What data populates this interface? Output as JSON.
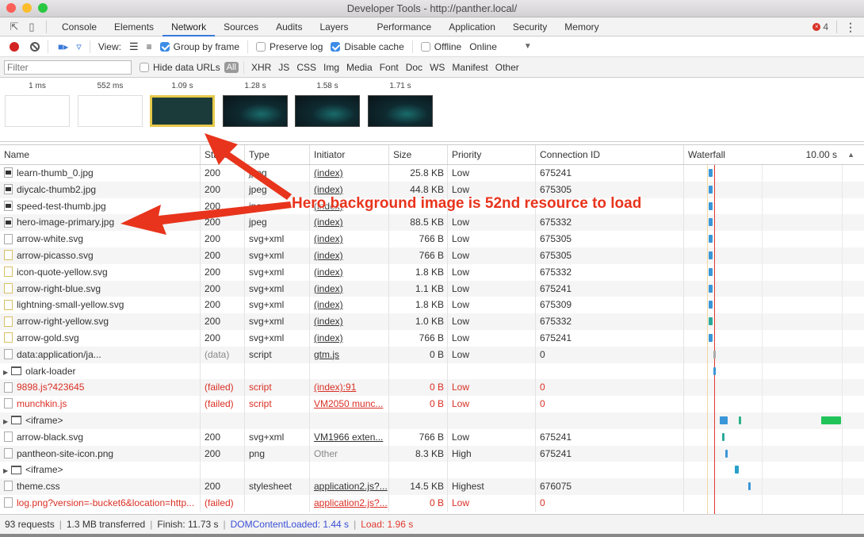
{
  "window": {
    "title": "Developer Tools - http://panther.local/"
  },
  "tabs": [
    "Console",
    "Elements",
    "Network",
    "Sources",
    "Audits",
    "Layers",
    "Performance",
    "Application",
    "Security",
    "Memory"
  ],
  "active_tab": "Network",
  "error_count": "4",
  "toolbar": {
    "view_label": "View:",
    "group_by_frame": {
      "label": "Group by frame",
      "checked": true
    },
    "preserve_log": {
      "label": "Preserve log",
      "checked": false
    },
    "disable_cache": {
      "label": "Disable cache",
      "checked": true
    },
    "offline": {
      "label": "Offline",
      "checked": false
    },
    "throttle": "Online"
  },
  "filterbar": {
    "placeholder": "Filter",
    "hide_data_urls": "Hide data URLs",
    "all": "All",
    "types": [
      "XHR",
      "JS",
      "CSS",
      "Img",
      "Media",
      "Font",
      "Doc",
      "WS",
      "Manifest",
      "Other"
    ]
  },
  "filmstrip": [
    {
      "time": "1 ms",
      "style": "blank"
    },
    {
      "time": "552 ms",
      "style": "blank"
    },
    {
      "time": "1.09 s",
      "style": "teal-selected"
    },
    {
      "time": "1.28 s",
      "style": "dark"
    },
    {
      "time": "1.58 s",
      "style": "dark"
    },
    {
      "time": "1.71 s",
      "style": "dark"
    }
  ],
  "columns": {
    "name": "Name",
    "status": "Status",
    "type": "Type",
    "initiator": "Initiator",
    "size": "Size",
    "priority": "Priority",
    "connection": "Connection ID",
    "waterfall": "Waterfall",
    "waterfall_scale": "10.00 s"
  },
  "rows": [
    {
      "name": "learn-thumb_0.jpg",
      "icon": "img",
      "status": "200",
      "type": "jpeg",
      "initiator": "(index)",
      "size": "25.8 KB",
      "priority": "Low",
      "conn": "675241"
    },
    {
      "name": "diycalc-thumb2.jpg",
      "icon": "img",
      "status": "200",
      "type": "jpeg",
      "initiator": "(index)",
      "size": "44.8 KB",
      "priority": "Low",
      "conn": "675305"
    },
    {
      "name": "speed-test-thumb.jpg",
      "icon": "img",
      "status": "200",
      "type": "jpeg",
      "initiator": "(index)",
      "size": "",
      "priority": "",
      "conn": ""
    },
    {
      "name": "hero-image-primary.jpg",
      "icon": "img",
      "status": "200",
      "type": "jpeg",
      "initiator": "(index)",
      "size": "88.5 KB",
      "priority": "Low",
      "conn": "675332"
    },
    {
      "name": "arrow-white.svg",
      "icon": "file",
      "status": "200",
      "type": "svg+xml",
      "initiator": "(index)",
      "size": "766 B",
      "priority": "Low",
      "conn": "675305"
    },
    {
      "name": "arrow-picasso.svg",
      "icon": "svg",
      "status": "200",
      "type": "svg+xml",
      "initiator": "(index)",
      "size": "766 B",
      "priority": "Low",
      "conn": "675305"
    },
    {
      "name": "icon-quote-yellow.svg",
      "icon": "svg",
      "status": "200",
      "type": "svg+xml",
      "initiator": "(index)",
      "size": "1.8 KB",
      "priority": "Low",
      "conn": "675332"
    },
    {
      "name": "arrow-right-blue.svg",
      "icon": "svg",
      "status": "200",
      "type": "svg+xml",
      "initiator": "(index)",
      "size": "1.1 KB",
      "priority": "Low",
      "conn": "675241"
    },
    {
      "name": "lightning-small-yellow.svg",
      "icon": "svg",
      "status": "200",
      "type": "svg+xml",
      "initiator": "(index)",
      "size": "1.8 KB",
      "priority": "Low",
      "conn": "675309"
    },
    {
      "name": "arrow-right-yellow.svg",
      "icon": "svg",
      "status": "200",
      "type": "svg+xml",
      "initiator": "(index)",
      "size": "1.0 KB",
      "priority": "Low",
      "conn": "675332"
    },
    {
      "name": "arrow-gold.svg",
      "icon": "svg",
      "status": "200",
      "type": "svg+xml",
      "initiator": "(index)",
      "size": "766 B",
      "priority": "Low",
      "conn": "675241"
    },
    {
      "name": "data:application/ja...",
      "icon": "file",
      "status": "(data)",
      "type": "script",
      "initiator": "gtm.js",
      "size": "0 B",
      "priority": "Low",
      "conn": "0",
      "status_grey": true
    },
    {
      "name": "olark-loader",
      "icon": "frame",
      "group": true
    },
    {
      "name": "9898.js?423645",
      "icon": "file",
      "status": "(failed)",
      "type": "script",
      "initiator": "(index):91",
      "size": "0 B",
      "priority": "Low",
      "conn": "0",
      "failed": true
    },
    {
      "name": "munchkin.js",
      "icon": "file",
      "status": "(failed)",
      "type": "script",
      "initiator": "VM2050 munc...",
      "size": "0 B",
      "priority": "Low",
      "conn": "0",
      "failed": true
    },
    {
      "name": "<iframe>",
      "icon": "frame",
      "group": true
    },
    {
      "name": "arrow-black.svg",
      "icon": "file",
      "status": "200",
      "type": "svg+xml",
      "initiator": "VM1966 exten...",
      "size": "766 B",
      "priority": "Low",
      "conn": "675241"
    },
    {
      "name": "pantheon-site-icon.png",
      "icon": "file",
      "status": "200",
      "type": "png",
      "initiator": "Other",
      "size": "8.3 KB",
      "priority": "High",
      "conn": "675241",
      "init_grey": true
    },
    {
      "name": "<iframe>",
      "icon": "frame",
      "group": true
    },
    {
      "name": "theme.css",
      "icon": "file",
      "status": "200",
      "type": "stylesheet",
      "initiator": "application2.js?...",
      "size": "14.5 KB",
      "priority": "Highest",
      "conn": "676075"
    },
    {
      "name": "log.png?version=-bucket6&location=http...",
      "icon": "file",
      "status": "(failed)",
      "type": "",
      "initiator": "application2.js?...",
      "size": "0 B",
      "priority": "Low",
      "conn": "0",
      "failed": true
    }
  ],
  "waterfall": {
    "dcl_color": "#3b5ee6",
    "load_color": "#e0392f",
    "bars": [
      {
        "row": 0,
        "start": 0.2,
        "len": 0.03,
        "color": "#3a96d8"
      },
      {
        "row": 1,
        "start": 0.2,
        "len": 0.03,
        "color": "#3a96d8"
      },
      {
        "row": 2,
        "start": 0.2,
        "len": 0.03,
        "color": "#3a96d8"
      },
      {
        "row": 3,
        "start": 0.2,
        "len": 0.03,
        "color": "#3a96d8"
      },
      {
        "row": 4,
        "start": 0.2,
        "len": 0.03,
        "color": "#3a96d8"
      },
      {
        "row": 5,
        "start": 0.2,
        "len": 0.03,
        "color": "#3a96d8"
      },
      {
        "row": 6,
        "start": 0.2,
        "len": 0.03,
        "color": "#3a96d8"
      },
      {
        "row": 7,
        "start": 0.2,
        "len": 0.03,
        "color": "#3a96d8"
      },
      {
        "row": 8,
        "start": 0.2,
        "len": 0.03,
        "color": "#3a96d8"
      },
      {
        "row": 9,
        "start": 0.2,
        "len": 0.03,
        "color": "#2aa99a"
      },
      {
        "row": 10,
        "start": 0.2,
        "len": 0.03,
        "color": "#3a96d8"
      },
      {
        "row": 11,
        "start": 0.24,
        "len": 0.01,
        "color": "#aaa"
      },
      {
        "row": 12,
        "start": 0.24,
        "len": 0.02,
        "color": "#3a96d8"
      },
      {
        "row": 15,
        "start": 0.29,
        "len": 0.07,
        "color": "#3a96d8"
      },
      {
        "row": 15,
        "start": 0.45,
        "len": 0.02,
        "color": "#2ab28a"
      },
      {
        "row": 15,
        "start": 1.14,
        "len": 0.17,
        "color": "#22c45a"
      },
      {
        "row": 16,
        "start": 0.31,
        "len": 0.01,
        "color": "#2aa99a"
      },
      {
        "row": 17,
        "start": 0.34,
        "len": 0.01,
        "color": "#3a96d8"
      },
      {
        "row": 18,
        "start": 0.42,
        "len": 0.03,
        "color": "#2aa0c8"
      },
      {
        "row": 19,
        "start": 0.53,
        "len": 0.01,
        "color": "#3a96d8"
      }
    ]
  },
  "status": {
    "requests": "93 requests",
    "transferred": "1.3 MB transferred",
    "finish": "Finish: 11.73 s",
    "dcl": "DOMContentLoaded: 1.44 s",
    "load": "Load: 1.96 s"
  },
  "annotation": {
    "text": "Hero background image is 52nd resource to load",
    "color": "#e8341c"
  }
}
